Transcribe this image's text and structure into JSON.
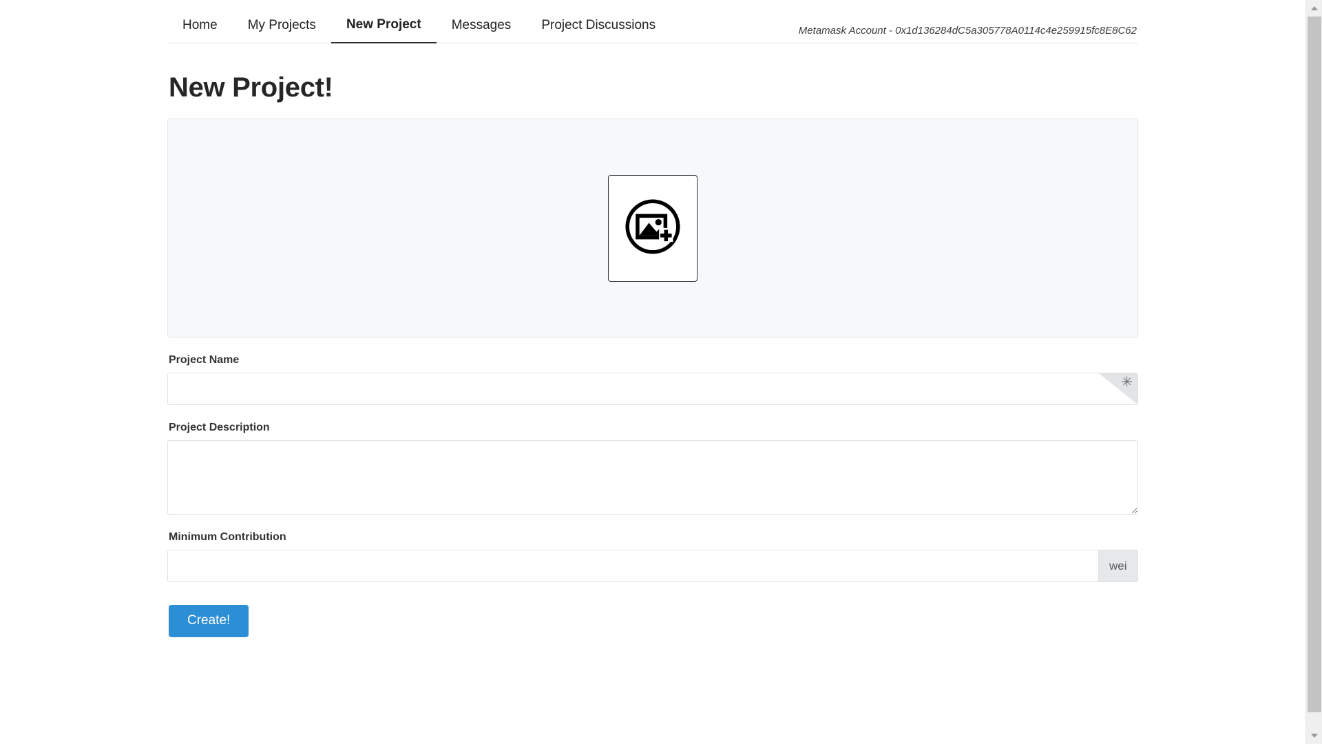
{
  "nav": {
    "items": [
      {
        "label": "Home",
        "active": false
      },
      {
        "label": "My Projects",
        "active": false
      },
      {
        "label": "New Project",
        "active": true
      },
      {
        "label": "Messages",
        "active": false
      },
      {
        "label": "Project Discussions",
        "active": false
      }
    ],
    "account_text": "Metamask Account - 0x1d136284dC5a305778A0114c4e259915fc8E8C62"
  },
  "page": {
    "title": "New Project!"
  },
  "image_upload": {
    "icon": "add-image-icon"
  },
  "form": {
    "project_name": {
      "label": "Project Name",
      "value": "",
      "placeholder": "",
      "required_marker": "✳"
    },
    "project_description": {
      "label": "Project Description",
      "value": "",
      "placeholder": ""
    },
    "minimum_contribution": {
      "label": "Minimum Contribution",
      "value": "",
      "placeholder": "",
      "unit": "wei"
    }
  },
  "actions": {
    "create_label": "Create!"
  },
  "colors": {
    "primary": "#2c8ed4",
    "dropzone_bg": "#f7f8f9",
    "addon_bg": "#e7e8ea"
  }
}
